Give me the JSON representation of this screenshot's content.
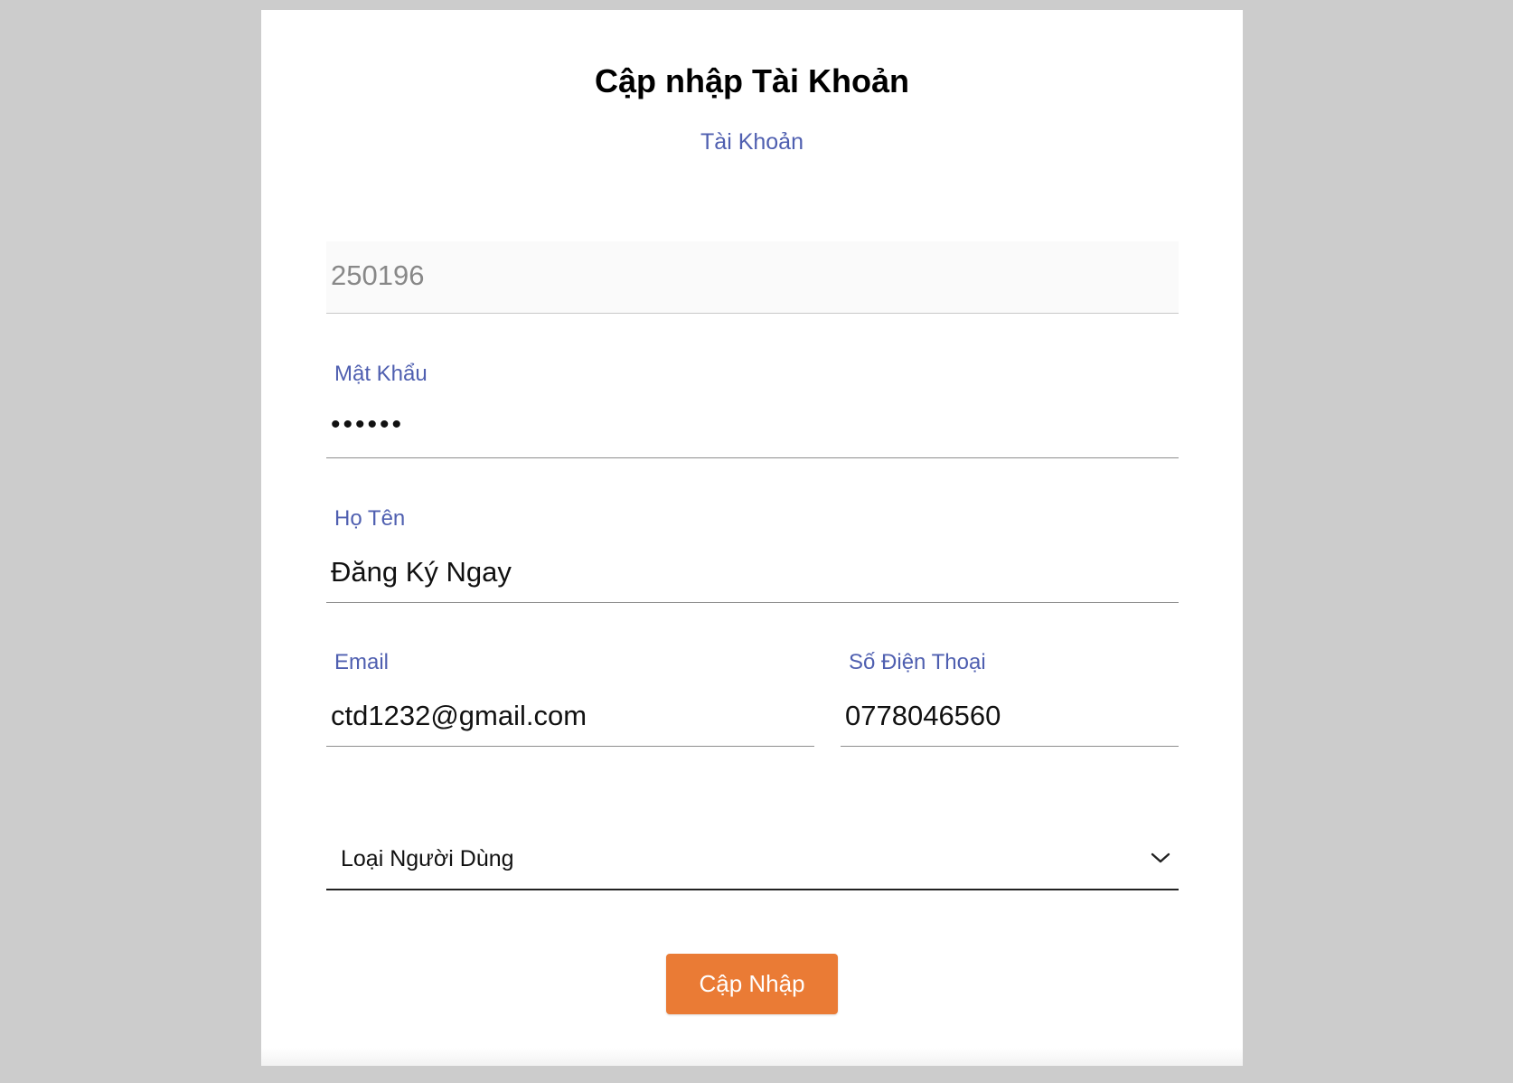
{
  "form": {
    "title": "Cập nhập Tài Khoản",
    "subtitle": "Tài Khoản",
    "username": {
      "value": "250196",
      "disabled": true
    },
    "password": {
      "label": "Mật Khẩu",
      "value": "••••••"
    },
    "fullname": {
      "label": "Họ Tên",
      "value": "Đăng Ký Ngay"
    },
    "email": {
      "label": "Email",
      "value": "ctd1232@gmail.com"
    },
    "phone": {
      "label": "Số Điện Thoại",
      "value": "0778046560"
    },
    "user_type": {
      "placeholder": "Loại Người Dùng",
      "icon": "chevron-down-icon"
    },
    "submit_label": "Cập Nhập"
  },
  "colors": {
    "background": "#cccccc",
    "card": "#ffffff",
    "label": "#4f5fb0",
    "button": "#ea7b35"
  }
}
